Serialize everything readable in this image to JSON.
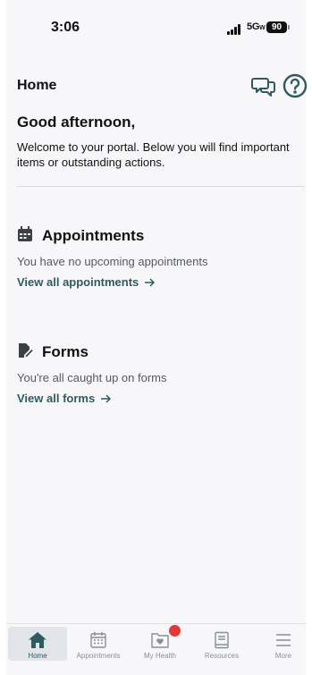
{
  "status_bar": {
    "time": "3:06",
    "network": "5G",
    "battery": "90"
  },
  "header": {
    "title": "Home"
  },
  "greeting": "Good afternoon,",
  "welcome_text": "Welcome to your portal. Below you will find important items or outstanding actions.",
  "sections": [
    {
      "title": "Appointments",
      "text": "You have no upcoming appointments",
      "link": "View all appointments",
      "icon": "calendar-icon"
    },
    {
      "title": "Forms",
      "text": "You're all caught up on forms",
      "link": "View all forms",
      "icon": "form-edit-icon"
    }
  ],
  "tabs": [
    {
      "label": "Home",
      "icon": "home-icon",
      "active": true
    },
    {
      "label": "Appointments",
      "icon": "calendar-icon",
      "active": false
    },
    {
      "label": "My Health",
      "icon": "heart-folder-icon",
      "active": false
    },
    {
      "label": "Resources",
      "icon": "book-icon",
      "active": false
    },
    {
      "label": "More",
      "icon": "menu-icon",
      "active": false
    }
  ],
  "colors": {
    "accent": "#2f5a60",
    "badge": "#e53935",
    "background": "#f7f7f9"
  }
}
